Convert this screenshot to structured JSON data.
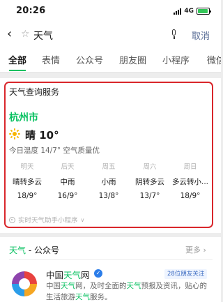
{
  "status_bar": {
    "time": "20:26",
    "network": "4G",
    "battery_level": 0.9
  },
  "search": {
    "query": "天气",
    "cancel_label": "取消"
  },
  "tabs": [
    "全部",
    "表情",
    "公众号",
    "朋友圈",
    "小程序",
    "微信"
  ],
  "weather_card": {
    "service_title": "天气查询服务",
    "city": "杭州市",
    "current": "晴 10°",
    "today_line": "今日温度 14/7° 空气质量优",
    "forecast": [
      {
        "day": "明天",
        "condition": "晴转多云",
        "temp": "18/9°"
      },
      {
        "day": "后天",
        "condition": "中雨",
        "temp": "16/9°"
      },
      {
        "day": "周五",
        "condition": "小雨",
        "temp": "13/8°"
      },
      {
        "day": "周六",
        "condition": "阴转多云",
        "temp": "13/7°"
      },
      {
        "day": "周日",
        "condition": "多云转小...",
        "temp": "18/9°"
      }
    ],
    "mini_program_link": "实时天气助手小程序"
  },
  "account_section": {
    "header_keyword": "天气",
    "header_rest": " - 公众号",
    "more_label": "更多",
    "account": {
      "name_prefix": "中国",
      "name_keyword": "天气",
      "name_suffix": "网",
      "friends_badge": "28位朋友关注",
      "description_parts": [
        "中国",
        "天气",
        "网，及时全面的",
        "天气",
        "预报及资讯，贴心的生活旅游",
        "天气",
        "服务。"
      ]
    }
  }
}
